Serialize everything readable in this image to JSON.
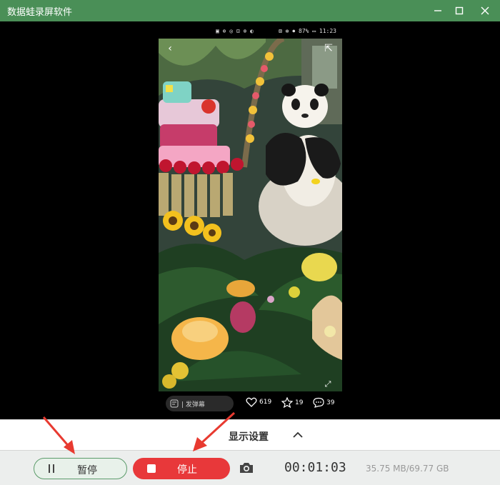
{
  "window": {
    "title": "数据蛙录屏软件",
    "controls": {
      "minimize": "—",
      "maximize": "☐",
      "close": "✕"
    }
  },
  "phone": {
    "status_center": "▣ ⊕ ◎ ⊡ ⊗ ◐",
    "status_right": "⊠ ✻ ⏺ 87% ▭ 11:23",
    "back_icon": "‹",
    "share_icon": "⇱",
    "expand_icon": "⤢",
    "danmu_label": "| 发弹幕",
    "likes": "619",
    "favorites": "19",
    "comments": "39"
  },
  "settings": {
    "label": "显示设置"
  },
  "controls": {
    "pause_label": "暂停",
    "stop_label": "停止",
    "timer": "00:01:03",
    "storage": "35.75 MB/69.77 GB"
  },
  "colors": {
    "titlebar": "#4a8f57",
    "stop": "#e8383a",
    "pause_border": "#5b9b6a"
  }
}
